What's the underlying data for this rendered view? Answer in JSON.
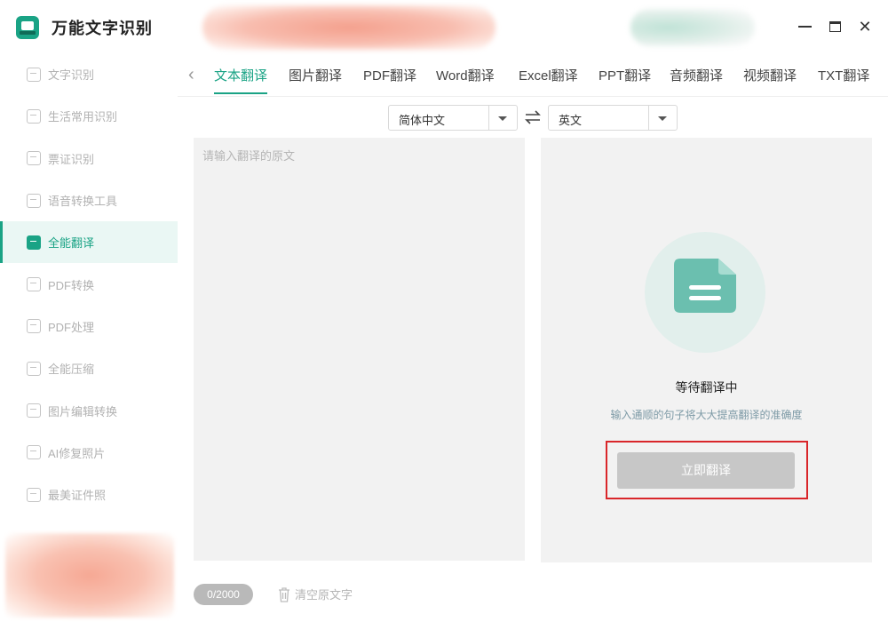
{
  "app": {
    "title": "万能文字识别",
    "brand_color": "#1aa385"
  },
  "sidebar": {
    "items": [
      {
        "label": "文字识别",
        "icon": "text-scan-icon"
      },
      {
        "label": "生活常用识别",
        "icon": "life-scan-icon"
      },
      {
        "label": "票证识别",
        "icon": "ticket-scan-icon"
      },
      {
        "label": "语音转换工具",
        "icon": "voice-convert-icon"
      },
      {
        "label": "全能翻译",
        "icon": "translate-icon",
        "active": true
      },
      {
        "label": "PDF转换",
        "icon": "pdf-convert-icon"
      },
      {
        "label": "PDF处理",
        "icon": "pdf-process-icon"
      },
      {
        "label": "全能压缩",
        "icon": "compress-icon"
      },
      {
        "label": "图片编辑转换",
        "icon": "image-edit-icon"
      },
      {
        "label": "AI修复照片",
        "icon": "ai-photo-icon"
      },
      {
        "label": "最美证件照",
        "icon": "id-photo-icon"
      }
    ]
  },
  "window": {
    "close_glyph": "✕"
  },
  "tabs": {
    "back_glyph": "‹",
    "items": [
      "文本翻译",
      "图片翻译",
      "PDF翻译",
      "Word翻译",
      "Excel翻译",
      "PPT翻译",
      "音频翻译",
      "视频翻译",
      "TXT翻译"
    ],
    "active": "文本翻译"
  },
  "languages": {
    "source": "简体中文",
    "target": "英文"
  },
  "source_panel": {
    "placeholder": "请输入翻译的原文",
    "value": ""
  },
  "target_panel": {
    "status_title": "等待翻译中",
    "tip": "输入通顺的句子将大大提高翻译的准确度",
    "translate_button": "立即翻译"
  },
  "footer": {
    "counter": "0/2000",
    "clear_label": "清空原文字"
  }
}
